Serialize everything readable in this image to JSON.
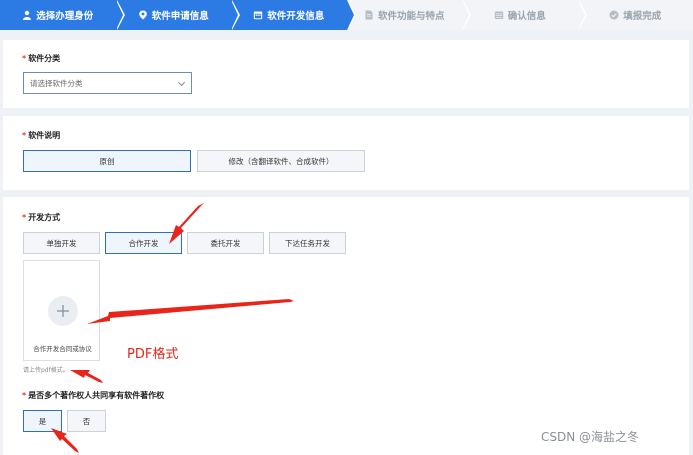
{
  "stepper": {
    "steps": [
      {
        "label": "选择办理身份",
        "state": "active"
      },
      {
        "label": "软件申请信息",
        "state": "active"
      },
      {
        "label": "软件开发信息",
        "state": "active"
      },
      {
        "label": "软件功能与特点",
        "state": "inactive"
      },
      {
        "label": "确认信息",
        "state": "inactive"
      },
      {
        "label": "填报完成",
        "state": "inactive"
      }
    ]
  },
  "category": {
    "label": "软件分类",
    "required": "*",
    "placeholder": "请选择软件分类"
  },
  "description": {
    "label": "软件说明",
    "required": "*",
    "options": [
      "原创",
      "修改（含翻译软件、合成软件）"
    ],
    "selected": "原创"
  },
  "development": {
    "label": "开发方式",
    "required": "*",
    "options": [
      "单独开发",
      "合作开发",
      "委托开发",
      "下达任务开发"
    ],
    "selected": "合作开发",
    "upload_label": "合作开发合同或协议",
    "upload_hint": "请上传pdf格式。"
  },
  "shared_copyright": {
    "label": "是否多个著作权人共同享有软件著作权",
    "required": "*",
    "options": [
      "是",
      "否"
    ],
    "selected": "是"
  },
  "annotation": "PDF格式",
  "watermark": "CSDN @海盐之冬",
  "colors": {
    "accent": "#2c7be5",
    "arrow": "#e8241b"
  }
}
